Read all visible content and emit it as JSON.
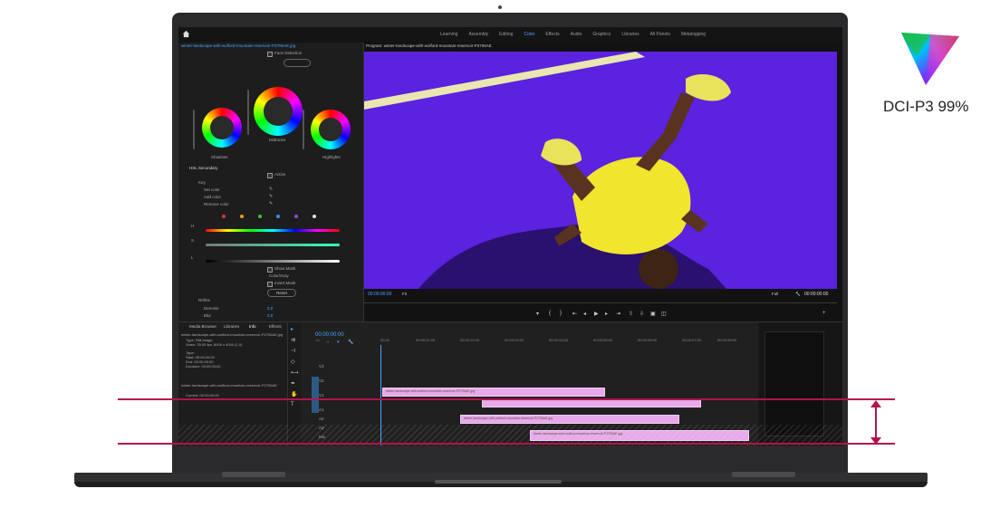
{
  "workspaces": {
    "tabs": [
      "Learning",
      "Assembly",
      "Editing",
      "Color",
      "Effects",
      "Audio",
      "Graphics",
      "Libraries",
      "All Panels",
      "Metalogging"
    ],
    "active": "Color"
  },
  "lumetri": {
    "header": "winter-landscape-with-wolford-mountain-reservoir-P2706AE.jpg",
    "face_detection": "Face Detection",
    "color_wheels": {
      "labels": [
        "Shadows",
        "Midtones",
        "Highlights"
      ]
    },
    "hsl": {
      "title": "HSL Secondary",
      "active": "Active",
      "key": "Key",
      "set_color": "Set color",
      "add_color": "Add color",
      "remove_color": "Remove color",
      "show_mask": "Show Mask",
      "color_gray": "Color/Gray",
      "invert_mask": "Invert Mask",
      "reset": "Reset",
      "refine": "Refine",
      "denoise": "Denoise",
      "denoise_val": "0.0",
      "blur": "Blur",
      "blur_val": "0.0"
    },
    "swatch_colors": [
      "#d23b3b",
      "#e0a020",
      "#3ec03e",
      "#3e8de0",
      "#8a4de0",
      "#e0e0e0"
    ]
  },
  "program": {
    "title": "Program: winter-landscape-with-wolford-mountain-reservoir-P2706AE",
    "timecode_left": "00:00:00:00",
    "fit": "Fit",
    "quality": "Full",
    "timecode_right": "00:00:00:00"
  },
  "project": {
    "tabs": [
      "Media Browser",
      "Libraries",
      "Info",
      "Effects"
    ],
    "clip_name": "winter-landscape-with-wolford-mountain-reservoir-P2706AE.jpg",
    "type_line": "Type: Still Image",
    "video_line": "Video: 25.00 fps, 6000 x 4000 (1.0)",
    "tape": "Tape:",
    "start": "Start: 00:00:00:00",
    "end": "End: 00:00:05:00",
    "duration": "Duration: 00:00:05:00",
    "seq_name": "winter-landscape-with-wolford-mountain-reservoir-P2706AE",
    "current": "Current: 00:00:00:00"
  },
  "timeline": {
    "timecode": "00:00:00:00",
    "ruler": [
      "00:00",
      "00:00:01:00",
      "00:00:02:00",
      "00:00:03:00",
      "00:00:04:00",
      "00:00:05:00",
      "00:00:06:00",
      "00:00:07:00",
      "00:00:08:00"
    ],
    "tracks": [
      "V3",
      "V2",
      "V1",
      "A1",
      "A2",
      "A3",
      "Mix"
    ],
    "clips": [
      {
        "label": "winter-landscape-with-wolford-mountain-reservoir-P2706AE.jpg"
      },
      {
        "label": ""
      },
      {
        "label": "winter-landscape-with-wolford-mountain-reservoir-P2706AE.jpg"
      },
      {
        "label": "winter-landscape-with-wolford-mountain-reservoir-P2706AE.jpg"
      }
    ]
  },
  "badge": {
    "label": "DCI-P3 99%"
  },
  "colors": {
    "accent": "#4aa3ff",
    "guide": "#b3134d",
    "video_bg": "#5b22e0",
    "clip": "#e7a9ea"
  }
}
